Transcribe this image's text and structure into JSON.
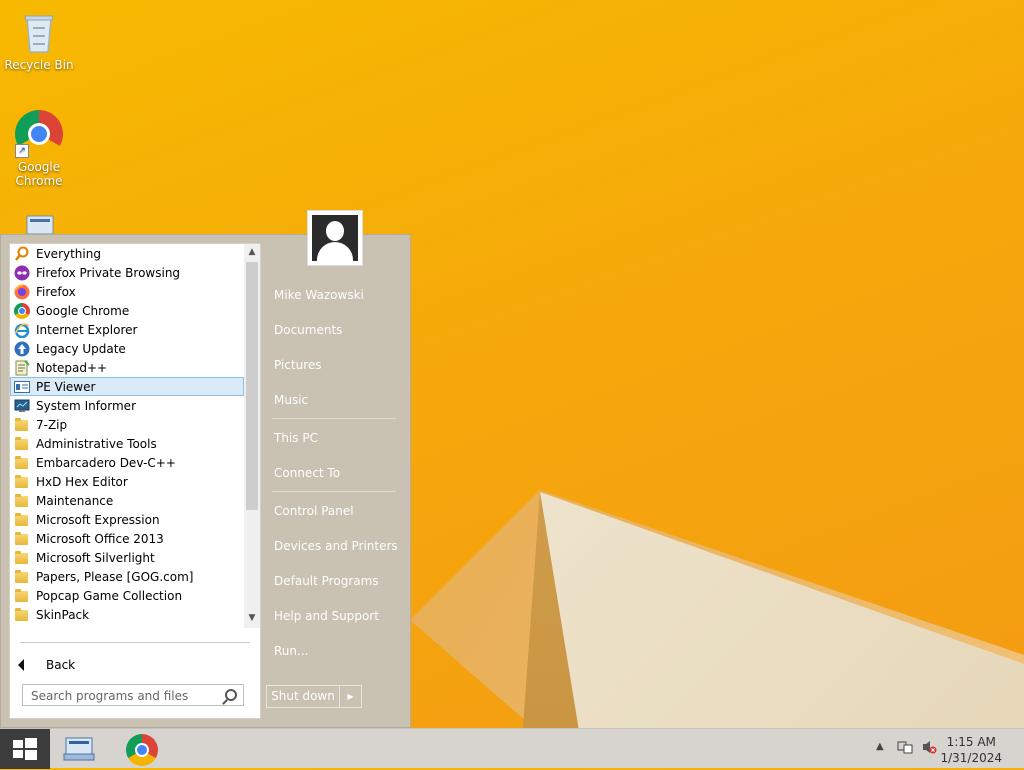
{
  "desktop": {
    "icons": [
      {
        "label": "Recycle Bin",
        "icon": "recycle-bin-icon"
      },
      {
        "label": "Google Chrome",
        "icon": "chrome-icon"
      },
      {
        "label": "",
        "icon": "keyboard-app-icon"
      }
    ]
  },
  "start_menu": {
    "programs": [
      {
        "label": "Everything",
        "icon": "everything-search-icon"
      },
      {
        "label": "Firefox Private Browsing",
        "icon": "firefox-private-icon"
      },
      {
        "label": "Firefox",
        "icon": "firefox-icon"
      },
      {
        "label": "Google Chrome",
        "icon": "chrome-icon"
      },
      {
        "label": "Internet Explorer",
        "icon": "internet-explorer-icon"
      },
      {
        "label": "Legacy Update",
        "icon": "legacy-update-icon"
      },
      {
        "label": "Notepad++",
        "icon": "notepadpp-icon"
      },
      {
        "label": "PE Viewer",
        "icon": "pe-viewer-icon",
        "selected": true
      },
      {
        "label": "System Informer",
        "icon": "system-informer-icon"
      },
      {
        "label": "7-Zip",
        "icon": "folder-icon"
      },
      {
        "label": "Administrative Tools",
        "icon": "folder-icon"
      },
      {
        "label": "Embarcadero Dev-C++",
        "icon": "folder-icon"
      },
      {
        "label": "HxD Hex Editor",
        "icon": "folder-icon"
      },
      {
        "label": "Maintenance",
        "icon": "folder-icon"
      },
      {
        "label": "Microsoft Expression",
        "icon": "folder-icon"
      },
      {
        "label": "Microsoft Office 2013",
        "icon": "folder-icon"
      },
      {
        "label": "Microsoft Silverlight",
        "icon": "folder-icon"
      },
      {
        "label": "Papers, Please [GOG.com]",
        "icon": "folder-icon"
      },
      {
        "label": "Popcap Game Collection",
        "icon": "folder-icon"
      },
      {
        "label": "SkinPack",
        "icon": "folder-icon"
      }
    ],
    "back_label": "Back",
    "search_placeholder": "Search programs and files",
    "user_name": "Mike Wazowski",
    "right_items": {
      "documents": "Documents",
      "pictures": "Pictures",
      "music": "Music",
      "this_pc": "This PC",
      "connect_to": "Connect To",
      "control_panel": "Control Panel",
      "devices_printers": "Devices and Printers",
      "default_programs": "Default Programs",
      "help_support": "Help and Support",
      "run": "Run..."
    },
    "shutdown_label": "Shut down"
  },
  "taskbar": {
    "time": "1:15 AM",
    "date": "1/31/2024"
  }
}
